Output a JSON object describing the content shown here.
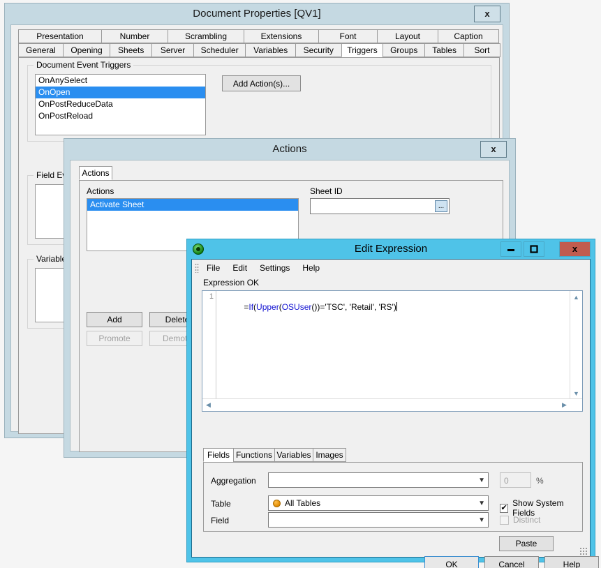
{
  "doc_properties": {
    "title": "Document Properties [QV1]",
    "close_label": "x",
    "tabs_row1": [
      "Presentation",
      "Number",
      "Scrambling",
      "Extensions",
      "Font",
      "Layout",
      "Caption"
    ],
    "tabs_row2": [
      "General",
      "Opening",
      "Sheets",
      "Server",
      "Scheduler",
      "Variables",
      "Security",
      "Triggers",
      "Groups",
      "Tables",
      "Sort"
    ],
    "active_tab": "Triggers",
    "doc_event_group_label": "Document Event Triggers",
    "triggers": [
      "OnAnySelect",
      "OnOpen",
      "OnPostReduceData",
      "OnPostReload"
    ],
    "selected_trigger": "OnOpen",
    "add_actions_label": "Add Action(s)...",
    "field_event_group_label": "Field Event",
    "variable_event_group_label": "Variable Ev"
  },
  "actions_dialog": {
    "title": "Actions",
    "close_label": "x",
    "tab_label": "Actions",
    "actions_list_label": "Actions",
    "actions": [
      "Activate Sheet"
    ],
    "selected_action": "Activate Sheet",
    "sheet_id_label": "Sheet ID",
    "sheet_id_value": "",
    "browse_label": "...",
    "buttons": {
      "add": "Add",
      "delete": "Delete",
      "promote": "Promote",
      "demote": "Demote"
    }
  },
  "edit_expression": {
    "title": "Edit Expression",
    "app_icon": "qlikview-icon",
    "window_controls": {
      "minimize": "minimize-icon",
      "maximize": "maximize-icon",
      "close": "x"
    },
    "menu": [
      "File",
      "Edit",
      "Settings",
      "Help"
    ],
    "status": "Expression OK",
    "editor": {
      "line_number": "1",
      "tokens": [
        {
          "text": "=",
          "type": "plain"
        },
        {
          "text": "If",
          "type": "function"
        },
        {
          "text": "(",
          "type": "plain"
        },
        {
          "text": "Upper",
          "type": "function"
        },
        {
          "text": "(",
          "type": "plain"
        },
        {
          "text": "OSUser",
          "type": "function"
        },
        {
          "text": "())='TSC', 'Retail', 'RS')",
          "type": "plain"
        }
      ],
      "full_text": "=If(Upper(OSUser())='TSC', 'Retail', 'RS')"
    },
    "bottom_tabs": [
      "Fields",
      "Functions",
      "Variables",
      "Images"
    ],
    "active_bottom_tab": "Fields",
    "fields_panel": {
      "aggregation_label": "Aggregation",
      "aggregation_value": "",
      "percent_value": "0",
      "percent_symbol": "%",
      "table_label": "Table",
      "table_value": "All Tables",
      "field_label": "Field",
      "field_value": "",
      "show_system_fields_label": "Show System Fields",
      "show_system_fields_checked": "✔",
      "distinct_label": "Distinct"
    },
    "buttons": {
      "paste": "Paste",
      "ok": "OK",
      "cancel": "Cancel",
      "help": "Help"
    }
  },
  "colors": {
    "selection_blue": "#2a8ef0",
    "aero_cyan": "#4fc3e8",
    "close_red": "#c15c4f",
    "function_blue": "#1414d2",
    "table_dot_orange": "#e08a00"
  }
}
